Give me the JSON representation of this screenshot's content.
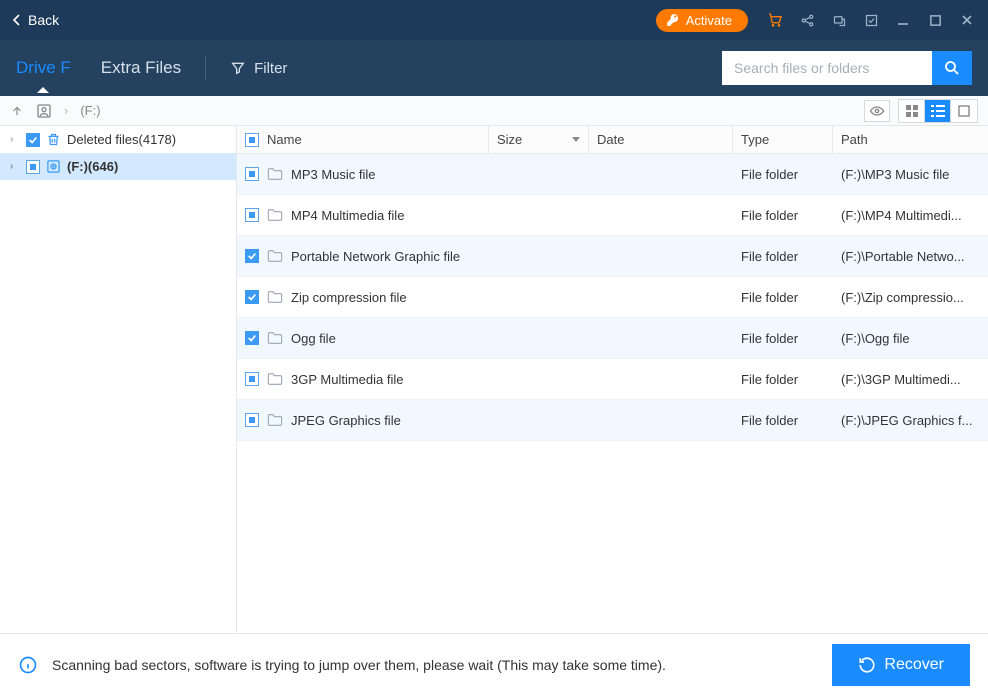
{
  "titlebar": {
    "back": "Back",
    "activate": "Activate"
  },
  "nav": {
    "tabs": [
      "Drive F",
      "Extra Files"
    ],
    "filter": "Filter",
    "search_placeholder": "Search files or folders"
  },
  "breadcrumb": "(F:)",
  "tree": [
    {
      "label": "Deleted files(4178)",
      "icon": "trash",
      "checked": "checked",
      "selected": false
    },
    {
      "label": "(F:)(646)",
      "icon": "drive",
      "checked": "partial",
      "selected": true
    }
  ],
  "columns": {
    "name": "Name",
    "size": "Size",
    "date": "Date",
    "type": "Type",
    "path": "Path"
  },
  "rows": [
    {
      "name": "MP3 Music file",
      "type": "File folder",
      "path": "(F:)\\MP3 Music file",
      "checked": "partial"
    },
    {
      "name": "MP4 Multimedia file",
      "type": "File folder",
      "path": "(F:)\\MP4 Multimedi...",
      "checked": "partial"
    },
    {
      "name": "Portable Network Graphic file",
      "type": "File folder",
      "path": "(F:)\\Portable Netwo...",
      "checked": "checked"
    },
    {
      "name": "Zip compression file",
      "type": "File folder",
      "path": "(F:)\\Zip compressio...",
      "checked": "checked"
    },
    {
      "name": "Ogg file",
      "type": "File folder",
      "path": "(F:)\\Ogg file",
      "checked": "checked"
    },
    {
      "name": "3GP Multimedia file",
      "type": "File folder",
      "path": "(F:)\\3GP Multimedi...",
      "checked": "partial"
    },
    {
      "name": "JPEG Graphics file",
      "type": "File folder",
      "path": "(F:)\\JPEG Graphics f...",
      "checked": "partial"
    }
  ],
  "footer": {
    "status": "Scanning bad sectors, software is trying to jump over them, please wait (This may take some time).",
    "recover": "Recover"
  }
}
